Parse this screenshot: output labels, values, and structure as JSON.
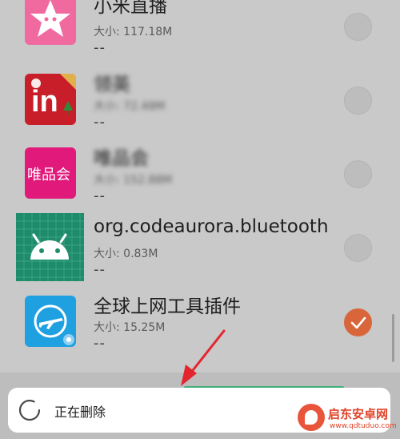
{
  "apps": [
    {
      "name": "小米直播",
      "size": "大小: 117.18M",
      "extra": "--",
      "blurred": false,
      "checked": false,
      "icon": "pink-star-icon"
    },
    {
      "name": "领英",
      "size": "大小: 72.48M",
      "extra": "--",
      "blurred": true,
      "checked": false,
      "icon": "linkedin-icon"
    },
    {
      "name": "唯品会",
      "size": "大小: 152.88M",
      "extra": "--",
      "blurred": true,
      "checked": false,
      "icon": "vipshop-icon",
      "icon_text": "唯品会"
    },
    {
      "name": "org.codeaurora.bluetooth",
      "size": "大小: 0.83M",
      "extra": "--",
      "blurred": false,
      "checked": false,
      "icon": "android-icon"
    },
    {
      "name": "全球上网工具插件",
      "size": "大小: 15.25M",
      "extra": "--",
      "blurred": false,
      "checked": true,
      "icon": "plane-icon"
    }
  ],
  "linkedin_icon_text": "in",
  "toast": {
    "text": "正在删除"
  },
  "watermark": {
    "name": "启东安卓网",
    "url": "www.qdtuduo.com"
  },
  "colors": {
    "check": "#d9663a",
    "linkedin": "#c81e2a",
    "vipshop": "#e0197a",
    "android_bg": "#1e8b6a",
    "plane": "#1fa0e0",
    "arrow": "#e3262d"
  }
}
